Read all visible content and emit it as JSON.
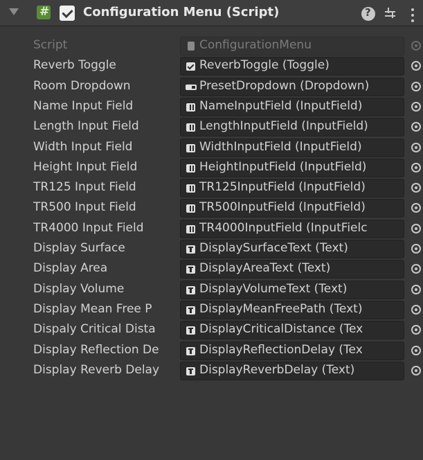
{
  "component": {
    "title": "Configuration Menu (Script)",
    "enabled": true
  },
  "header_icons": {
    "foldout": "foldout-triangle-icon",
    "script": "csharp-script-icon",
    "help": "help-icon",
    "presets": "presets-icon",
    "menu": "kebab-menu-icon"
  },
  "fields": [
    {
      "label": "Script",
      "value": "ConfigurationMenu",
      "icon": "script-icon",
      "disabled": true
    },
    {
      "label": "Reverb Toggle",
      "value": "ReverbToggle (Toggle)",
      "icon": "toggle-icon"
    },
    {
      "label": "Room Dropdown",
      "value": "PresetDropdown (Dropdown)",
      "icon": "dropdown-icon"
    },
    {
      "label": "Name Input Field",
      "value": "NameInputField (InputField)",
      "icon": "inputfield-icon"
    },
    {
      "label": "Length Input Field",
      "value": "LengthInputField (InputField)",
      "icon": "inputfield-icon"
    },
    {
      "label": "Width Input Field",
      "value": "WidthInputField (InputField)",
      "icon": "inputfield-icon"
    },
    {
      "label": "Height Input Field",
      "value": "HeightInputField (InputField)",
      "icon": "inputfield-icon"
    },
    {
      "label": "TR125 Input Field",
      "value": "TR125InputField (InputField)",
      "icon": "inputfield-icon"
    },
    {
      "label": "TR500 Input Field",
      "value": "TR500InputField (InputField)",
      "icon": "inputfield-icon"
    },
    {
      "label": "TR4000 Input Field",
      "value": "TR4000InputField (InputFielc",
      "icon": "inputfield-icon"
    },
    {
      "label": "Display Surface",
      "value": "DisplaySurfaceText (Text)",
      "icon": "text-icon"
    },
    {
      "label": "Display Area",
      "value": "DisplayAreaText (Text)",
      "icon": "text-icon"
    },
    {
      "label": "Display Volume",
      "value": "DisplayVolumeText (Text)",
      "icon": "text-icon"
    },
    {
      "label": "Display Mean Free P",
      "value": "DisplayMeanFreePath (Text)",
      "icon": "text-icon"
    },
    {
      "label": "Dispaly Critical Dista",
      "value": "DisplayCriticalDistance (Tex",
      "icon": "text-icon"
    },
    {
      "label": "Display Reflection De",
      "value": "DisplayReflectionDelay (Tex",
      "icon": "text-icon"
    },
    {
      "label": "Display Reverb Delay",
      "value": "DisplayReverbDelay (Text)",
      "icon": "text-icon"
    }
  ]
}
